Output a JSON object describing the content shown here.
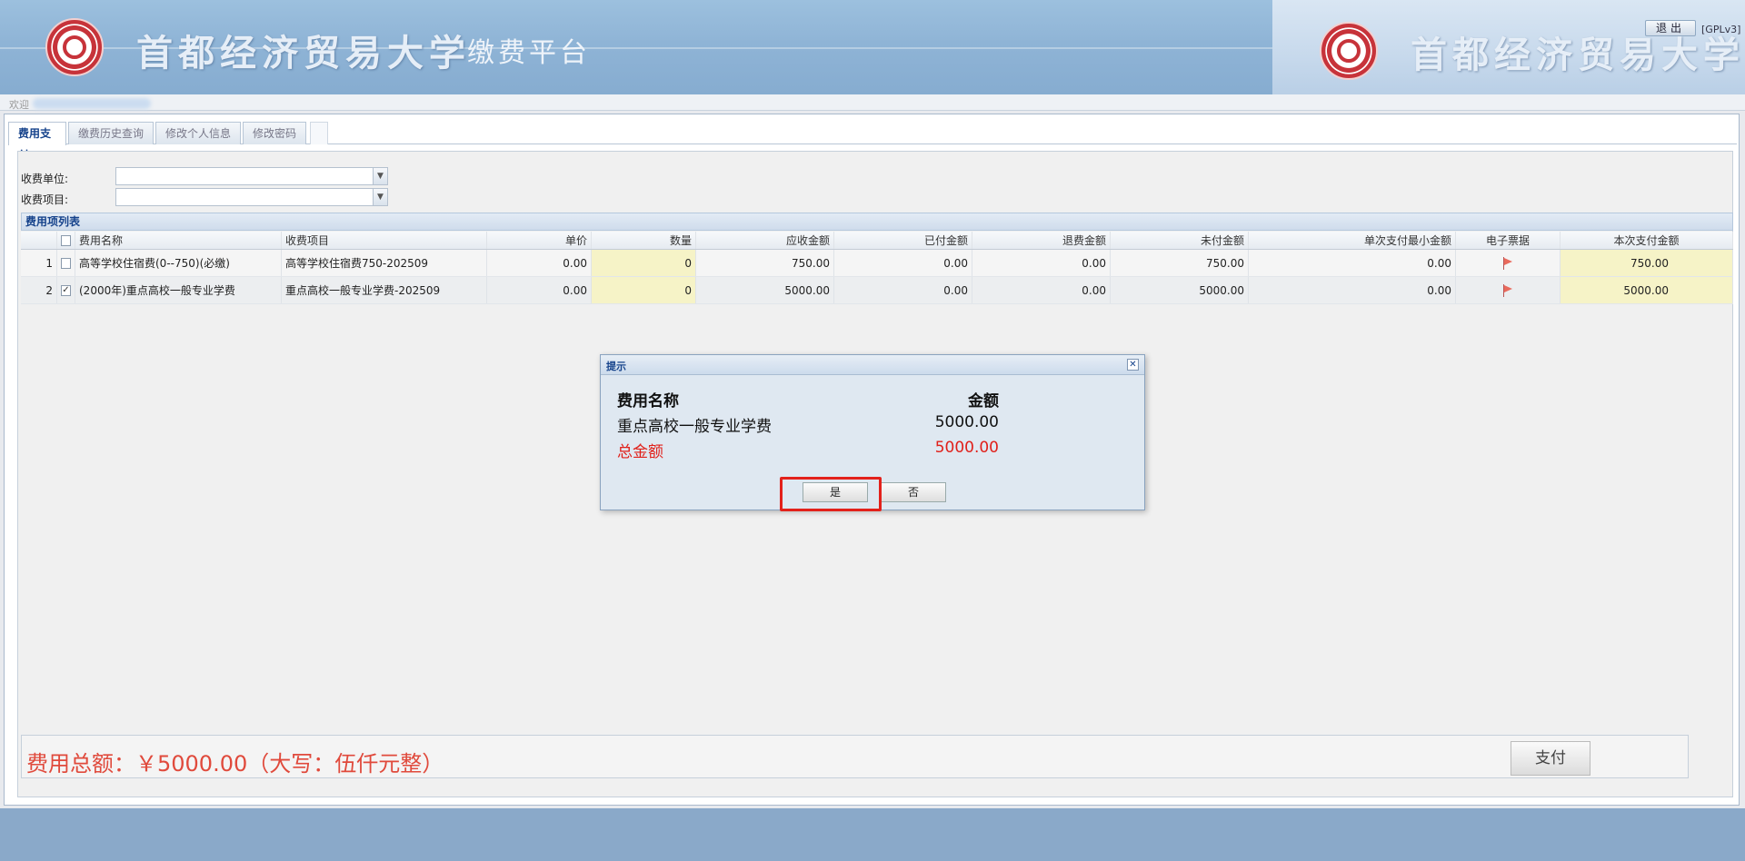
{
  "header": {
    "university": "首都经济贸易大学",
    "platform": "缴费平台",
    "university_right": "首都经济贸易大学",
    "logout_label": "退出",
    "license": "[GPLv3]"
  },
  "welcome": {
    "label": "欢迎"
  },
  "tabs": [
    {
      "label": "费用支付",
      "active": true
    },
    {
      "label": "缴费历史查询",
      "active": false
    },
    {
      "label": "修改个人信息",
      "active": false
    },
    {
      "label": "修改密码",
      "active": false
    }
  ],
  "form": {
    "unit_label": "收费单位:",
    "unit_value": "",
    "item_label": "收费项目:",
    "item_value": ""
  },
  "grid": {
    "title": "费用项列表",
    "columns": [
      "费用名称",
      "收费项目",
      "单价",
      "数量",
      "应收金额",
      "已付金额",
      "退费金额",
      "未付金额",
      "单次支付最小金额",
      "电子票据",
      "本次支付金额"
    ],
    "rows": [
      {
        "no": "1",
        "checked": false,
        "name": "高等学校住宿费(0--750)(必缴)",
        "item": "高等学校住宿费750-202509",
        "price": "0.00",
        "qty": "0",
        "receivable": "750.00",
        "paid": "0.00",
        "refund": "0.00",
        "unpaid": "750.00",
        "min": "0.00",
        "current": "750.00"
      },
      {
        "no": "2",
        "checked": true,
        "name": "(2000年)重点高校一般专业学费",
        "item": "重点高校一般专业学费-202509",
        "price": "0.00",
        "qty": "0",
        "receivable": "5000.00",
        "paid": "0.00",
        "refund": "0.00",
        "unpaid": "5000.00",
        "min": "0.00",
        "current": "5000.00"
      }
    ]
  },
  "summary": {
    "total_text": "费用总额：￥5000.00（大写：伍仟元整）",
    "pay_label": "支付"
  },
  "dialog": {
    "title": "提示",
    "close_glyph": "✕",
    "header_name": "费用名称",
    "header_amount": "金额",
    "item_name": "重点高校一般专业学费",
    "item_amount": "5000.00",
    "total_label": "总金额",
    "total_amount": "5000.00",
    "yes_label": "是",
    "no_label": "否"
  },
  "colors": {
    "header_bg": "#8fb4d6",
    "accent_red": "#e0201a",
    "tab_active": "#15428b",
    "editable_cell": "#f6f3c7"
  }
}
